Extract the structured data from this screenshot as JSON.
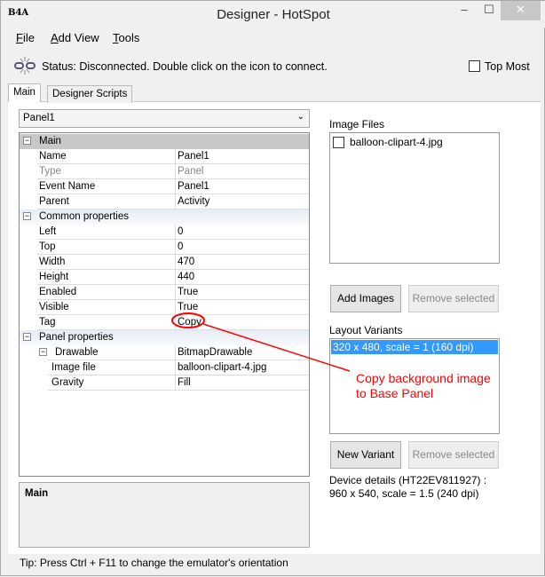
{
  "window": {
    "title": "Designer - HotSpot",
    "logo": "B4A",
    "minimize": "–",
    "maximize": "☐",
    "close": "✕"
  },
  "menu": [
    {
      "label": "File"
    },
    {
      "label": "Add View"
    },
    {
      "label": "Tools"
    }
  ],
  "status": {
    "text": "Status: Disconnected. Double click on the icon to connect.",
    "icon": "disconnected-link-icon",
    "top_most": "Top Most",
    "top_most_checked": false
  },
  "tabs": [
    {
      "label": "Main",
      "active": true
    },
    {
      "label": "Designer Scripts",
      "active": false
    }
  ],
  "view_selector": {
    "value": "Panel1"
  },
  "properties": [
    {
      "type": "section",
      "label": "Main"
    },
    {
      "k": "Name",
      "v": "Panel1"
    },
    {
      "k": "Type",
      "v": "Panel",
      "disabled": true
    },
    {
      "k": "Event Name",
      "v": "Panel1"
    },
    {
      "k": "Parent",
      "v": "Activity"
    },
    {
      "type": "section",
      "label": "Common properties"
    },
    {
      "k": "Left",
      "v": "0"
    },
    {
      "k": "Top",
      "v": "0"
    },
    {
      "k": "Width",
      "v": "470"
    },
    {
      "k": "Height",
      "v": "440"
    },
    {
      "k": "Enabled",
      "v": "True"
    },
    {
      "k": "Visible",
      "v": "True"
    },
    {
      "k": "Tag",
      "v": "Copy"
    },
    {
      "type": "section",
      "label": "Panel properties"
    },
    {
      "k": "Drawable",
      "v": "BitmapDrawable",
      "expander": true
    },
    {
      "k": "Image file",
      "v": "balloon-clipart-4.jpg",
      "sub": true
    },
    {
      "k": "Gravity",
      "v": "Fill",
      "sub": true
    }
  ],
  "description": {
    "title": "Main"
  },
  "image_files": {
    "label": "Image Files",
    "items": [
      "balloon-clipart-4.jpg"
    ],
    "add": "Add Images",
    "remove": "Remove selected"
  },
  "layout_variants": {
    "label": "Layout Variants",
    "items": [
      "320 x 480, scale = 1 (160 dpi)"
    ],
    "new": "New Variant",
    "remove": "Remove selected"
  },
  "device_details": {
    "line1": "Device details (HT22EV811927) :",
    "line2": "960 x 540, scale = 1.5 (240 dpi)"
  },
  "tip": "Tip: Press Ctrl + F11 to change the emulator's orientation",
  "annotation": {
    "line1": "Copy background image",
    "line2": "to Base Panel",
    "color": "#ff0000"
  }
}
